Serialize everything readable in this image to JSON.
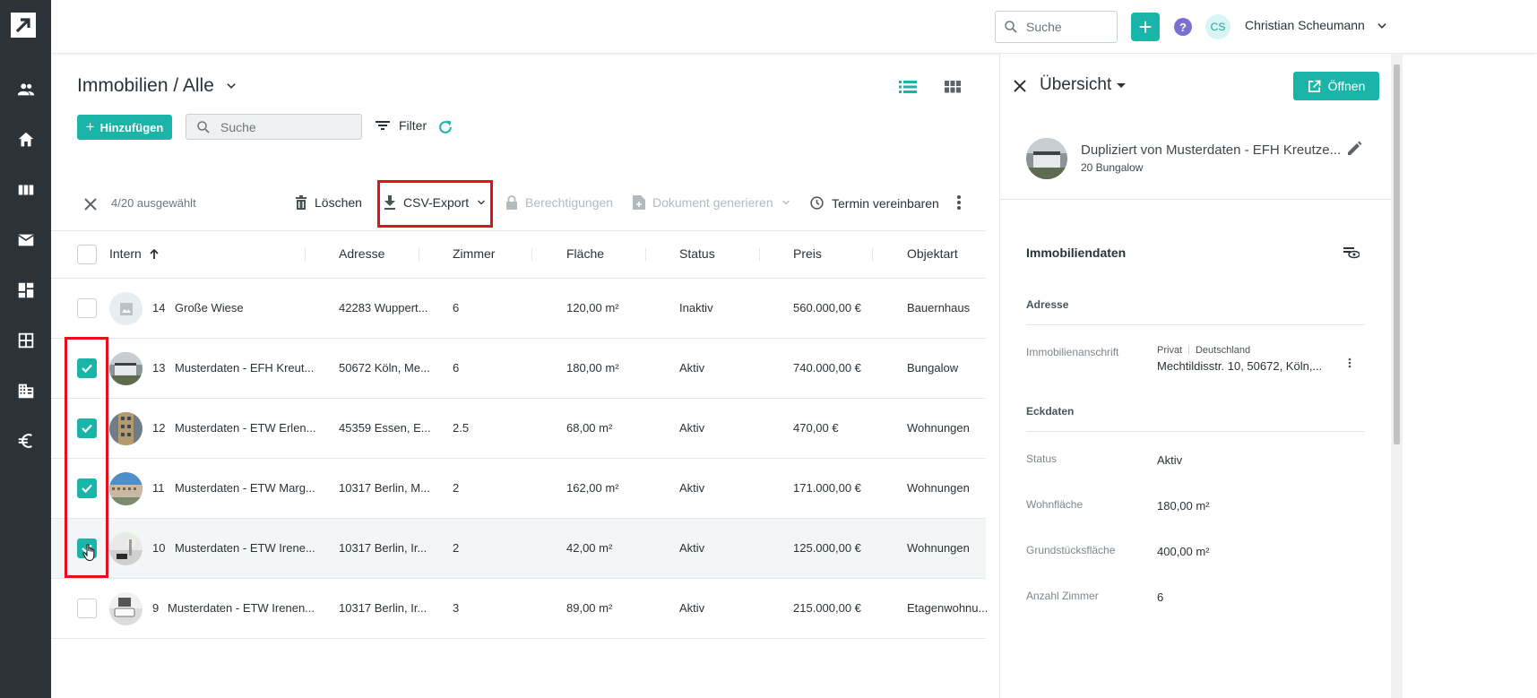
{
  "topbar": {
    "search_placeholder": "Suche",
    "avatar_initials": "CS",
    "user_name": "Christian Scheumann",
    "help_label": "?"
  },
  "nav": {
    "items": [
      "people-icon",
      "home-icon",
      "view-columns-icon",
      "mail-icon",
      "dashboard-icon",
      "grid-icon",
      "building-icon",
      "euro-icon"
    ]
  },
  "list": {
    "title": "Immobilien / Alle",
    "add_label": "Hinzufügen",
    "search_placeholder": "Suche",
    "filter_label": "Filter"
  },
  "bulk": {
    "count": "4/20 ausgewählt",
    "delete": "Löschen",
    "csv_export": "CSV-Export",
    "permissions": "Berechtigungen",
    "generate_doc": "Dokument generieren",
    "schedule": "Termin vereinbaren"
  },
  "table": {
    "headers": [
      "Intern",
      "Adresse",
      "Zimmer",
      "Fläche",
      "Status",
      "Preis",
      "Objektart"
    ],
    "rows": [
      {
        "id": "14",
        "name": "Große Wiese",
        "address": "42283 Wuppert...",
        "rooms": "6",
        "area": "120,00 m²",
        "status": "Inaktiv",
        "price": "560.000,00 €",
        "type": "Bauernhaus",
        "checked": false
      },
      {
        "id": "13",
        "name": "Musterdaten - EFH Kreut...",
        "address": "50672 Köln, Me...",
        "rooms": "6",
        "area": "180,00 m²",
        "status": "Aktiv",
        "price": "740.000,00 €",
        "type": "Bungalow",
        "checked": true
      },
      {
        "id": "12",
        "name": "Musterdaten - ETW Erlen...",
        "address": "45359 Essen, E...",
        "rooms": "2.5",
        "area": "68,00 m²",
        "status": "Aktiv",
        "price": "470,00 €",
        "type": "Wohnungen",
        "checked": true
      },
      {
        "id": "11",
        "name": "Musterdaten - ETW Marg...",
        "address": "10317 Berlin, M...",
        "rooms": "2",
        "area": "162,00 m²",
        "status": "Aktiv",
        "price": "171.000,00 €",
        "type": "Wohnungen",
        "checked": true
      },
      {
        "id": "10",
        "name": "Musterdaten - ETW Irene...",
        "address": "10317 Berlin, Ir...",
        "rooms": "2",
        "area": "42,00 m²",
        "status": "Aktiv",
        "price": "125.000,00 €",
        "type": "Wohnungen",
        "checked": true
      },
      {
        "id": "9",
        "name": "Musterdaten - ETW Irenen...",
        "address": "10317 Berlin, Ir...",
        "rooms": "3",
        "area": "89,00 m²",
        "status": "Aktiv",
        "price": "215.000,00 €",
        "type": "Etagenwohnu...",
        "checked": false
      }
    ]
  },
  "detail": {
    "title": "Übersicht",
    "open_label": "Öffnen",
    "property_name": "Dupliziert von Musterdaten - EFH Kreutze...",
    "property_sub": "20 Bungalow",
    "section_title": "Immobiliendaten",
    "address_heading": "Adresse",
    "address_label": "Immobilienanschrift",
    "address_tag1": "Privat",
    "address_tag2": "Deutschland",
    "address_value": "Mechtildisstr. 10, 50672, Köln,...",
    "key_heading": "Eckdaten",
    "fields": [
      {
        "label": "Status",
        "value": "Aktiv"
      },
      {
        "label": "Wohnfläche",
        "value": "180,00 m²"
      },
      {
        "label": "Grundstücksfläche",
        "value": "400,00 m²"
      },
      {
        "label": "Anzahl Zimmer",
        "value": "6"
      }
    ]
  },
  "colors": {
    "accent": "#1ab5a8",
    "nav_bg": "#2b3238",
    "highlight": "#e3101e"
  }
}
